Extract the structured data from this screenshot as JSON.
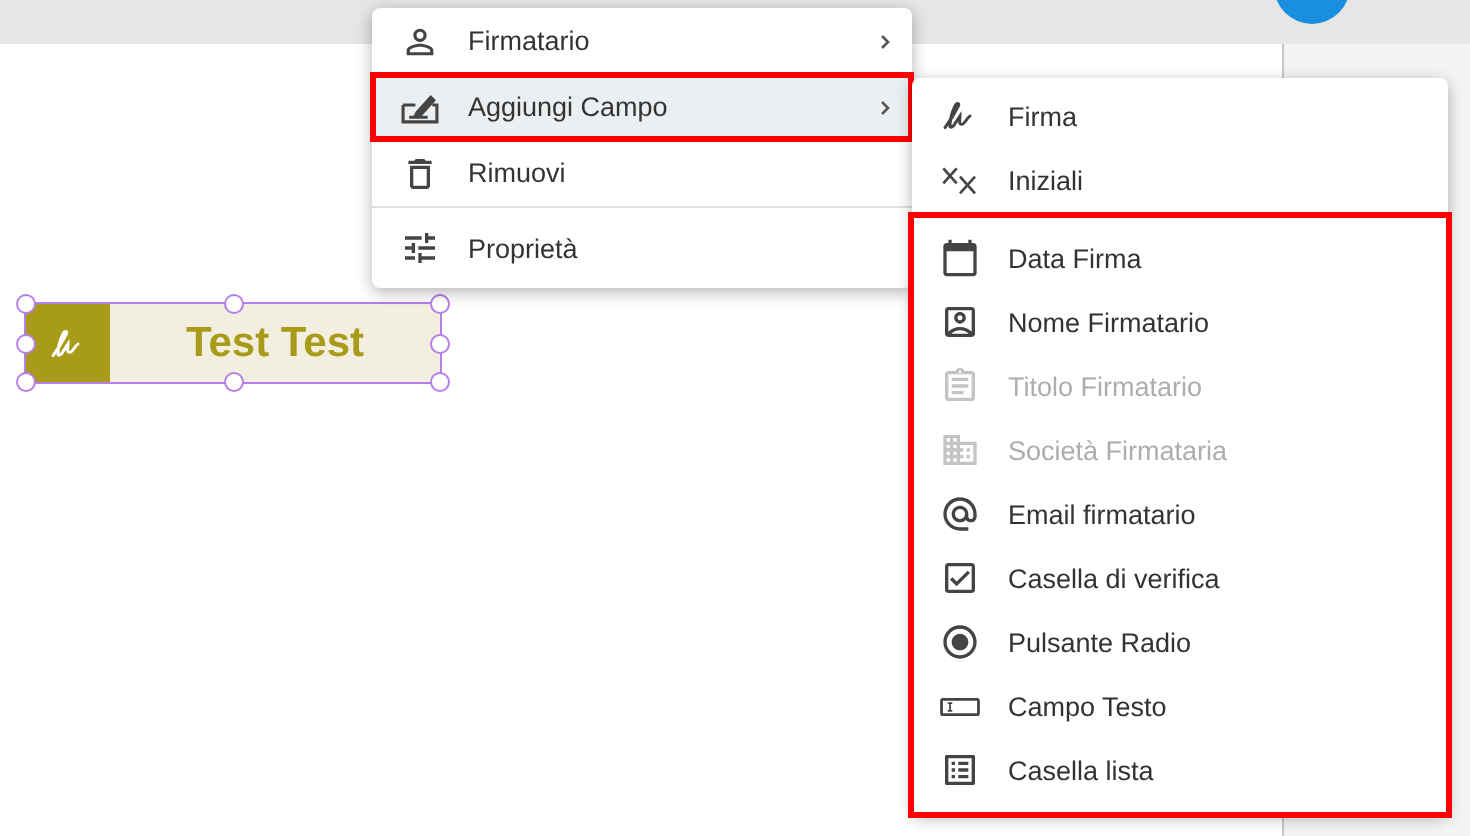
{
  "canvas": {
    "field": {
      "text": "Test Test",
      "selected": true
    }
  },
  "context_menu": {
    "groups": [
      {
        "items": [
          {
            "label": "Firmatario",
            "has_submenu": true,
            "highlighted": false
          },
          {
            "label": "Aggiungi Campo",
            "has_submenu": true,
            "highlighted": true
          },
          {
            "label": "Rimuovi",
            "has_submenu": false,
            "highlighted": false
          }
        ]
      },
      {
        "items": [
          {
            "label": "Proprietà",
            "has_submenu": false,
            "highlighted": false
          }
        ]
      }
    ]
  },
  "submenu": {
    "groups": [
      {
        "highlighted": false,
        "items": [
          {
            "label": "Firma",
            "disabled": false
          },
          {
            "label": "Iniziali",
            "disabled": false
          }
        ]
      },
      {
        "highlighted": true,
        "items": [
          {
            "label": "Data Firma",
            "disabled": false
          },
          {
            "label": "Nome Firmatario",
            "disabled": false
          },
          {
            "label": "Titolo Firmatario",
            "disabled": true
          },
          {
            "label": "Società Firmataria",
            "disabled": true
          },
          {
            "label": "Email firmatario",
            "disabled": false
          },
          {
            "label": "Casella di verifica",
            "disabled": false
          },
          {
            "label": "Pulsante Radio",
            "disabled": false
          },
          {
            "label": "Campo Testo",
            "disabled": false
          },
          {
            "label": "Casella lista",
            "disabled": false
          }
        ]
      }
    ]
  }
}
